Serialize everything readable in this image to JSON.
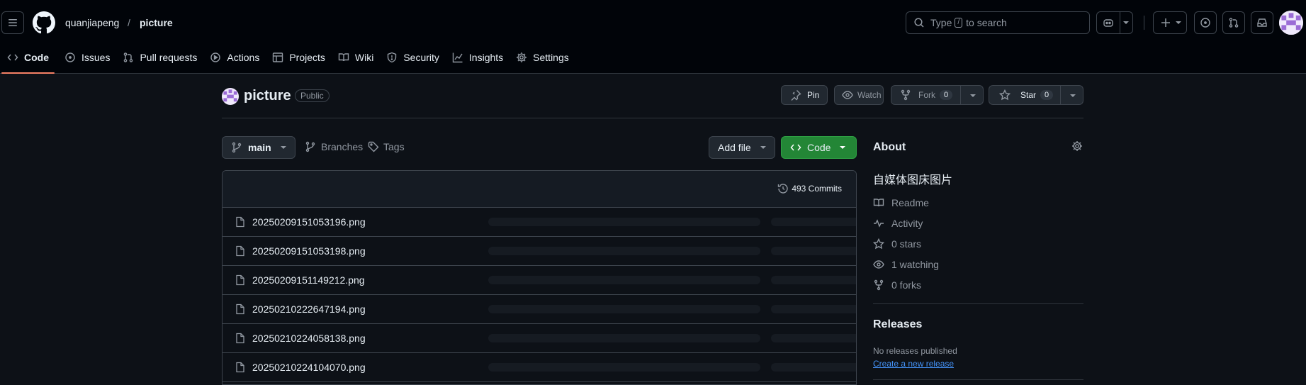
{
  "header": {
    "owner": "quanjiapeng",
    "separator": "/",
    "repo": "picture",
    "search_prefix": "Type",
    "search_key": "/",
    "search_suffix": "to search"
  },
  "tabs": [
    {
      "label": "Code",
      "icon": "code-icon"
    },
    {
      "label": "Issues",
      "icon": "issue-icon"
    },
    {
      "label": "Pull requests",
      "icon": "pull-request-icon"
    },
    {
      "label": "Actions",
      "icon": "play-icon"
    },
    {
      "label": "Projects",
      "icon": "table-icon"
    },
    {
      "label": "Wiki",
      "icon": "book-icon"
    },
    {
      "label": "Security",
      "icon": "shield-icon"
    },
    {
      "label": "Insights",
      "icon": "graph-icon"
    },
    {
      "label": "Settings",
      "icon": "gear-icon"
    }
  ],
  "repo_header": {
    "name": "picture",
    "visibility": "Public",
    "pin": "Pin",
    "watch": "Watch",
    "fork": "Fork",
    "fork_count": "0",
    "star": "Star",
    "star_count": "0"
  },
  "toolbar": {
    "branch": "main",
    "branches": "Branches",
    "tags": "Tags",
    "add_file": "Add file",
    "code": "Code"
  },
  "files": {
    "commits": "493 Commits",
    "rows": [
      "20250209151053196.png",
      "20250209151053198.png",
      "20250209151149212.png",
      "20250210222647194.png",
      "20250210224058138.png",
      "20250210224104070.png"
    ]
  },
  "about": {
    "title": "About",
    "description": "自媒体图床图片",
    "readme": "Readme",
    "activity": "Activity",
    "stars": "0 stars",
    "watching": "1 watching",
    "forks": "0 forks"
  },
  "releases": {
    "title": "Releases",
    "none": "No releases published",
    "create": "Create a new release"
  },
  "colors": {
    "accent_green": "#238636",
    "tab_underline": "#f78166",
    "link": "#4493f8"
  }
}
